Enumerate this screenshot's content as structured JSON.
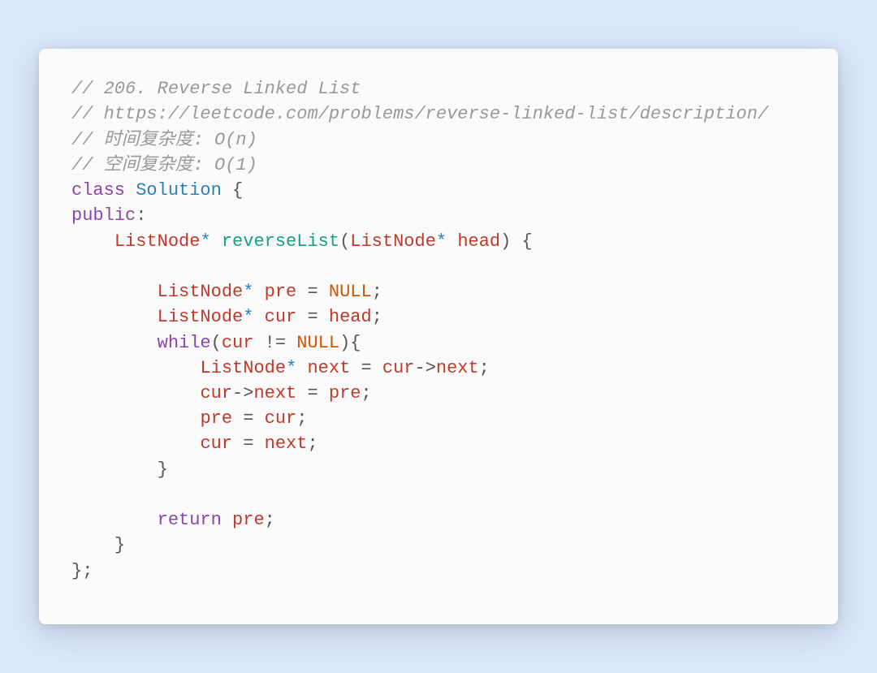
{
  "code": {
    "comment1": "// 206. Reverse Linked List",
    "comment2": "// https://leetcode.com/problems/reverse-linked-list/description/",
    "comment3": "// 时间复杂度: O(n)",
    "comment4": "// 空间复杂度: O(1)",
    "kw_class": "class",
    "classname": "Solution",
    "brace_open": "{",
    "kw_public": "public",
    "colon": ":",
    "type_listnode": "ListNode",
    "star": "*",
    "fn_reverseList": "reverseList",
    "paren_open": "(",
    "param_head": "head",
    "paren_close": ")",
    "var_pre": "pre",
    "eq": "=",
    "null_lit": "NULL",
    "semi": ";",
    "var_cur": "cur",
    "kw_while": "while",
    "neq": "!=",
    "var_next": "next",
    "arrow": "->",
    "member_next": "next",
    "brace_close": "}",
    "kw_return": "return",
    "end_semi": ";"
  }
}
